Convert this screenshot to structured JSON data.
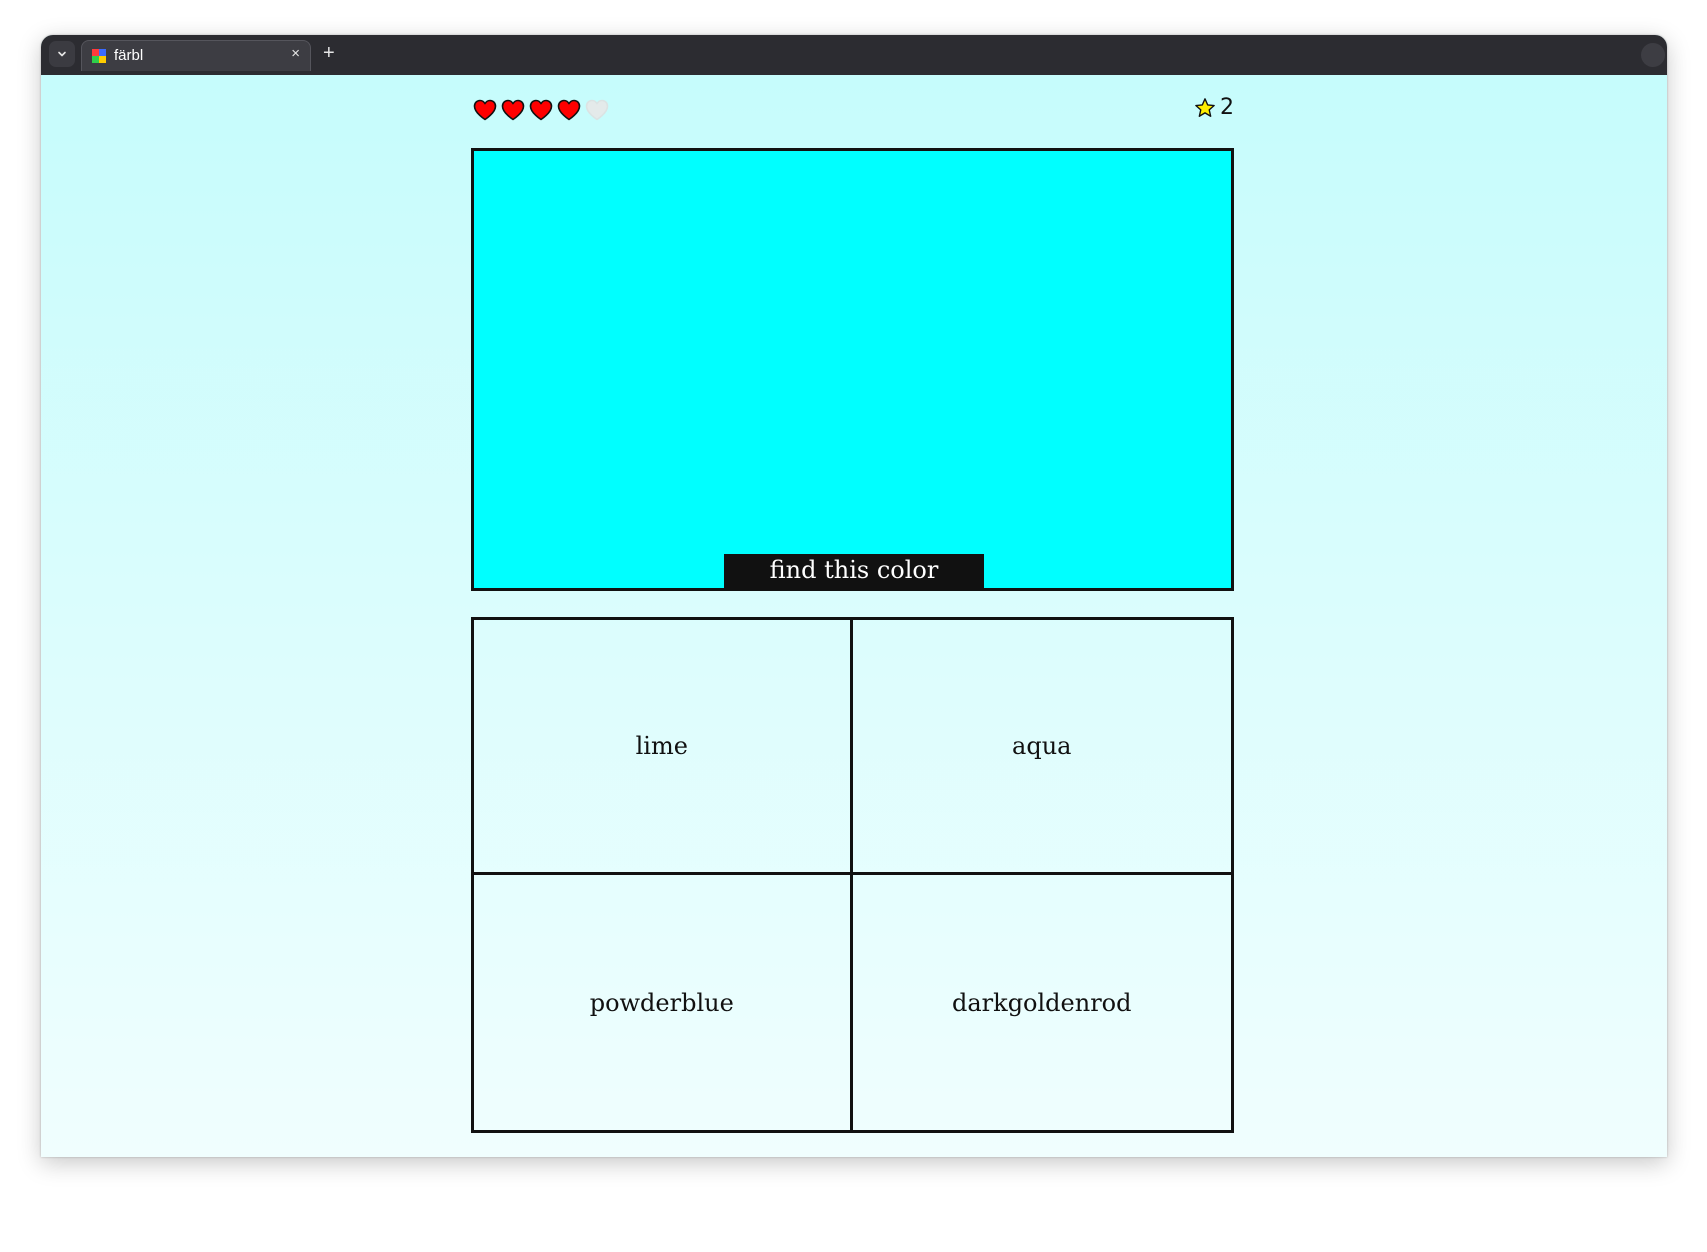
{
  "browser": {
    "tab_title": "färbl",
    "close_glyph": "×",
    "new_tab_glyph": "+"
  },
  "game": {
    "lives_total": 5,
    "lives_remaining": 4,
    "score": "2",
    "target_color": "#00ffff",
    "swatch_label": "find this color",
    "options": [
      "lime",
      "aqua",
      "powderblue",
      "darkgoldenrod"
    ]
  },
  "colors": {
    "page_background": "#c6fcfc",
    "heart_full": "#ff0000",
    "heart_empty": "#e4eaea",
    "star": "#ffee00"
  }
}
